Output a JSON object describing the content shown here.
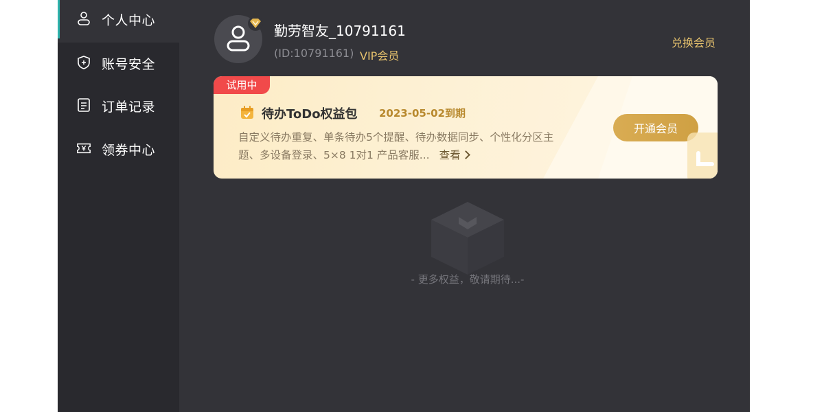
{
  "sidebar": {
    "items": [
      {
        "label": "个人中心",
        "icon": "user-icon",
        "active": true
      },
      {
        "label": "账号安全",
        "icon": "shield-icon",
        "active": false
      },
      {
        "label": "订单记录",
        "icon": "order-list-icon",
        "active": false
      },
      {
        "label": "领券中心",
        "icon": "coupon-icon",
        "active": false
      }
    ]
  },
  "profile": {
    "username": "勤劳智友_10791161",
    "user_id": "(ID:10791161)",
    "vip_tag": "VIP会员",
    "redeem_label": "兑换会员"
  },
  "benefit_card": {
    "badge": "试用中",
    "title": "待办ToDo权益包",
    "expire": "2023-05-02到期",
    "description": "自定义待办重复、单条待办5个提醒、待办数据同步、个性化分区主题、多设备登录、5×8 1对1 产品客服...",
    "view_label": "查看",
    "open_button": "开通会员"
  },
  "empty_state": {
    "text": "- 更多权益，敬请期待...-"
  },
  "colors": {
    "window_bg": "#333338",
    "sidebar_bg": "#29292e",
    "active_indicator": "#2fb3ad",
    "gold_accent": "#e9c46e",
    "trial_badge": "#f14a4a",
    "open_button": "#d9ac53"
  }
}
